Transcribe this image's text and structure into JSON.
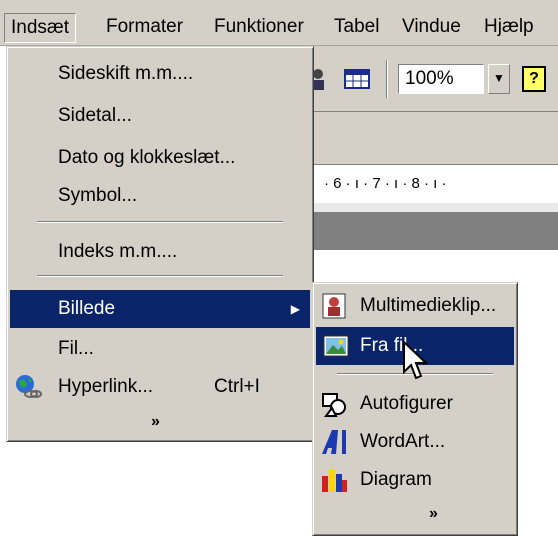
{
  "menubar": {
    "items": [
      {
        "label": "Indsæt"
      },
      {
        "label": "Formater"
      },
      {
        "label": "Funktioner"
      },
      {
        "label": "Tabel"
      },
      {
        "label": "Vindue"
      },
      {
        "label": "Hjælp"
      }
    ]
  },
  "toolbar": {
    "zoom_value": "100%",
    "help_label": "?"
  },
  "ruler": {
    "text": "· 6 · ı · 7 · ı · 8 · ı ·"
  },
  "insert_menu": {
    "items": [
      {
        "label": "Sideskift m.m...."
      },
      {
        "label": "Sidetal..."
      },
      {
        "label": "Dato og klokkeslæt..."
      },
      {
        "label": "Symbol..."
      },
      {
        "label": "Indeks m.m...."
      },
      {
        "label": "Billede"
      },
      {
        "label": "Fil..."
      },
      {
        "label": "Hyperlink...",
        "shortcut": "Ctrl+I"
      }
    ],
    "expand_glyph": "»"
  },
  "picture_submenu": {
    "items": [
      {
        "label": "Multimedieklip..."
      },
      {
        "label": "Fra fil..."
      },
      {
        "label": "Autofigurer"
      },
      {
        "label": "WordArt..."
      },
      {
        "label": "Diagram"
      }
    ],
    "expand_glyph": "»"
  },
  "colors": {
    "menu_bg": "#d4d0c8",
    "highlight": "#0a246a",
    "highlight_text": "#ffffff"
  }
}
